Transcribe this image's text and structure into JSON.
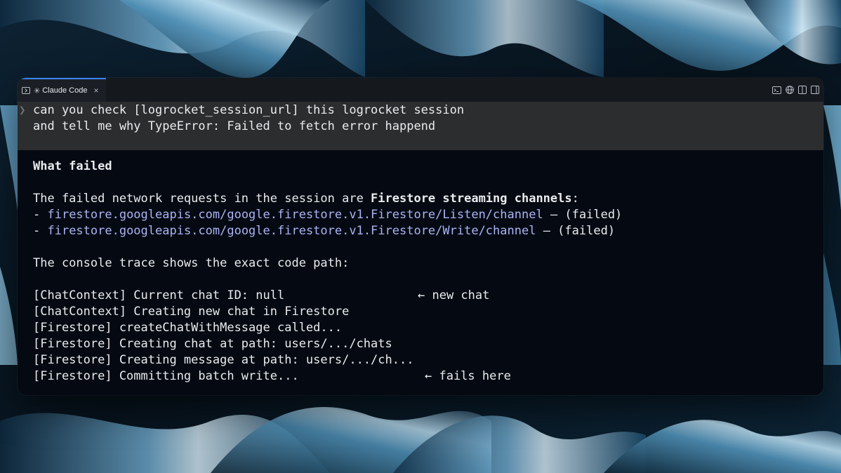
{
  "window": {
    "tab_icon": "terminal-icon",
    "tab_star": "✳",
    "tab_title": "Claude Code",
    "tab_close": "×",
    "actions": [
      "terminal-icon",
      "globe-icon",
      "split-view-icon",
      "panel-icon"
    ]
  },
  "prompt": {
    "chevron": "❯",
    "line1": "can you check [logrocket_session_url] this logrocket session",
    "line2": "and tell me why TypeError: Failed to fetch error happend"
  },
  "response": {
    "heading": "What failed",
    "intro_prefix": "The failed network requests in the session are ",
    "intro_bold": "Firestore streaming channels",
    "intro_suffix": ":",
    "requests": [
      {
        "bullet": "- ",
        "url": "firestore.googleapis.com/google.firestore.v1.Firestore/Listen/channel",
        "status": " — (failed)"
      },
      {
        "bullet": "- ",
        "url": "firestore.googleapis.com/google.firestore.v1.Firestore/Write/channel",
        "status": " — (failed)"
      }
    ],
    "trace_intro": "The console trace shows the exact code path:",
    "trace": [
      {
        "text": "[ChatContext] Current chat ID: null",
        "note": "← new chat"
      },
      {
        "text": "[ChatContext] Creating new chat in Firestore",
        "note": ""
      },
      {
        "text": "[Firestore] createChatWithMessage called...",
        "note": ""
      },
      {
        "text": "[Firestore] Creating chat at path: users/.../chats",
        "note": ""
      },
      {
        "text": "[Firestore] Creating message at path: users/.../ch...",
        "note": ""
      },
      {
        "text": "[Firestore] Committing batch write...",
        "note": "← fails here"
      }
    ]
  },
  "colors": {
    "accent_tab": "#3b82f6",
    "link": "#a9b4f5",
    "prompt_bg": "#2c2d2f",
    "terminal_bg": "#050a12"
  }
}
